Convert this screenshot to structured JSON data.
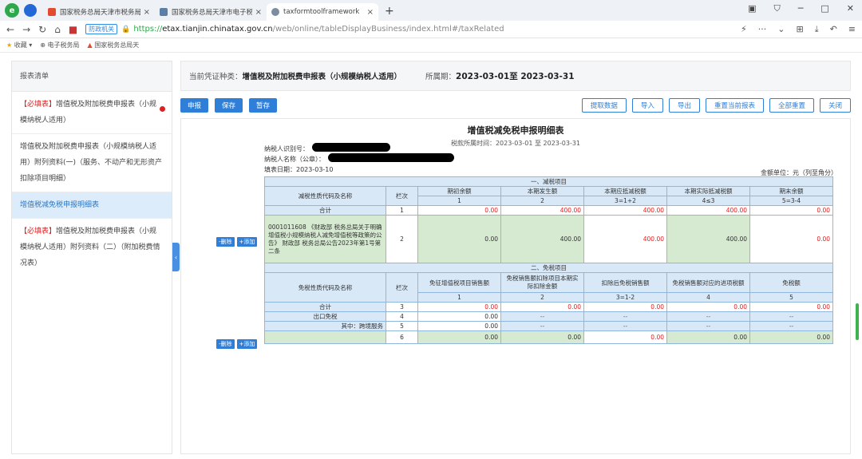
{
  "browser": {
    "tabs": [
      {
        "label": "国家税务总局天津市税务局",
        "active": false
      },
      {
        "label": "国家税务总局天津市电子税务",
        "active": false
      },
      {
        "label": "taxformtoolframework",
        "active": true
      }
    ],
    "new_tab": "+",
    "security_badge": "防政机关",
    "url_https": "https://",
    "url_host": "etax.tianjin.chinatax.gov.cn",
    "url_path": "/web/online/tableDisplayBusiness/index.html#/taxRelated",
    "favorites": [
      "收藏",
      "电子税务局",
      "国家税务总局天"
    ]
  },
  "sidebar": {
    "header": "报表清单",
    "items": [
      {
        "prefix": "【必填表】",
        "label": "增值税及附加税费申报表（小规模纳税人适用）",
        "required": true
      },
      {
        "prefix": "",
        "label": "增值税及附加税费申报表（小规模纳税人适用）附列资料(一)（服务、不动产和无形资产扣除项目明细）",
        "required": false
      },
      {
        "prefix": "",
        "label": "增值税减免税申报明细表",
        "required": false,
        "active": true
      },
      {
        "prefix": "【必填表】",
        "label": "增值税及附加税费申报表（小规模纳税人适用）附列资料（二）（附加税费情况表）",
        "required": true
      }
    ]
  },
  "infobar": {
    "voucher_label": "当前凭证种类：",
    "voucher_value": "增值税及附加税费申报表（小规模纳税人适用）",
    "period_label": "所属期：",
    "period_value": "2023-03-01至 2023-03-31"
  },
  "toolbar": {
    "declare": "申报",
    "save": "保存",
    "draft": "暂存",
    "fetch": "提取数据",
    "import": "导入",
    "export": "导出",
    "reset_current": "重置当前报表",
    "reset_all": "全部重置",
    "close": "关闭"
  },
  "form": {
    "title": "增值税减免税申报明细表",
    "period": "税款所属时间：2023-03-01 至 2023-03-31",
    "taxpayer_id_label": "纳税人识别号：",
    "taxpayer_name_label": "纳税人名称（公章）：",
    "fill_date": "填表日期：2023-03-10",
    "unit": "金额单位：元（列至角分）",
    "section1": {
      "title": "一、减税项目",
      "col_name": "减税性质代码及名称",
      "col_line": "栏次",
      "headers": [
        "期初余额",
        "本期发生额",
        "本期应抵减税额",
        "本期实际抵减税额",
        "期末余额"
      ],
      "subheaders": [
        "1",
        "2",
        "3=1+2",
        "4≤3",
        "5=3-4"
      ],
      "rows": [
        {
          "name": "合计",
          "line": "1",
          "values": [
            "0.00",
            "400.00",
            "400.00",
            "400.00",
            "0.00"
          ]
        },
        {
          "name": "0001011608 《财政部 税务总局关于明确增值税小规模纳税人减免增值税等政策的公告》 财政部 税务总局公告2023年第1号第二条",
          "line": "2",
          "values": [
            "0.00",
            "400.00",
            "400.00",
            "400.00",
            "0.00"
          ]
        }
      ]
    },
    "section2": {
      "title": "二、免税项目",
      "col_name": "免税性质代码及名称",
      "col_line": "栏次",
      "headers": [
        "免征增值税项目销售额",
        "免税销售额扣除项目本期实际扣除金额",
        "扣除后免税销售额",
        "免税销售额对应的进项税额",
        "免税额"
      ],
      "subheaders": [
        "1",
        "2",
        "3=1-2",
        "4",
        "5"
      ],
      "rows": [
        {
          "name": "合计",
          "line": "3",
          "values": [
            "0.00",
            "0.00",
            "0.00",
            "0.00",
            "0.00"
          ]
        },
        {
          "name": "出口免税",
          "line": "4",
          "values": [
            "0.00",
            "--",
            "--",
            "--",
            "--"
          ]
        },
        {
          "name": "其中：跨境服务",
          "line": "5",
          "values": [
            "0.00",
            "--",
            "--",
            "--",
            "--"
          ]
        },
        {
          "name": "",
          "line": "6",
          "values": [
            "0.00",
            "0.00",
            "0.00",
            "0.00",
            "0.00"
          ]
        }
      ]
    },
    "row_buttons": {
      "delete": "-删除",
      "add": "+添加"
    }
  }
}
